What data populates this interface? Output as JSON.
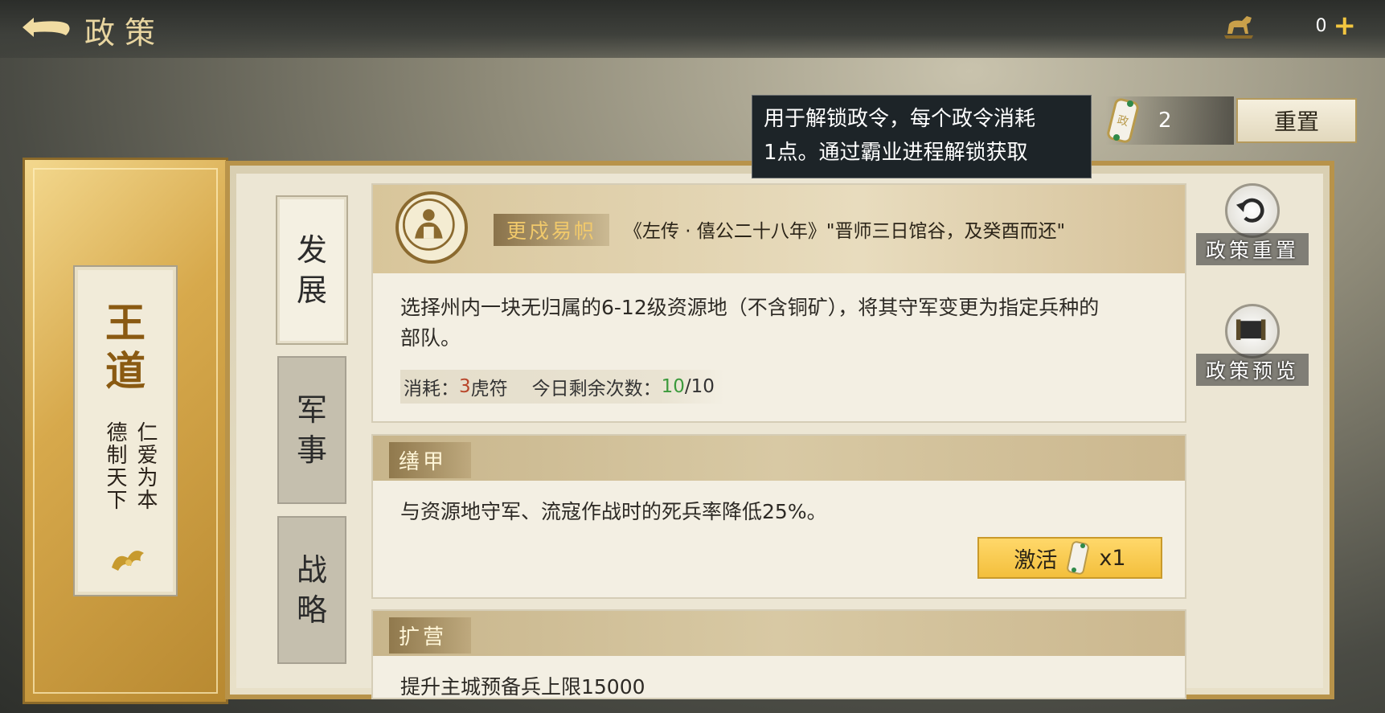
{
  "header": {
    "title": "政策",
    "currency_value": "0",
    "plus_label": "+"
  },
  "tooltip": {
    "line1": "用于解锁政令，每个政令消耗",
    "line2": "1点。通过霸业进程解锁获取"
  },
  "token": {
    "count": "2",
    "icon_glyph": "政"
  },
  "reset_button": "重置",
  "side_card": {
    "title_1": "王",
    "title_2": "道",
    "motto_1": "仁爱为本",
    "motto_2": "德制天下"
  },
  "tabs": [
    {
      "label_1": "发",
      "label_2": "展",
      "active": true
    },
    {
      "label_1": "军",
      "label_2": "事",
      "active": false
    },
    {
      "label_1": "战",
      "label_2": "略",
      "active": false
    }
  ],
  "policy_1": {
    "name": "更戍易帜",
    "quote": "《左传 · 僖公二十八年》\"晋师三日馆谷，及癸酉而还\"",
    "desc_line1": "选择州内一块无归属的6-12级资源地（不含铜矿），将其守军变更为指定兵种的",
    "desc_line2": "部队。",
    "cost_label": "消耗：",
    "cost_num": "3",
    "cost_unit": "虎符",
    "remain_label": "今日剩余次数：",
    "remain_num": "10",
    "remain_total": "/10"
  },
  "policy_2": {
    "name": "缮甲",
    "desc": "与资源地守军、流寇作战时的死兵率降低25%。",
    "activate_label": "激活",
    "activate_count": "x1"
  },
  "policy_3": {
    "name": "扩营",
    "desc": "提升主城预备兵上限15000"
  },
  "right_actions": {
    "reset_label": "政策重置",
    "preview_label": "政策预览"
  },
  "colors": {
    "gold": "#f2c640",
    "cost_red": "#b8452a",
    "remain_green": "#3c9a3c"
  }
}
